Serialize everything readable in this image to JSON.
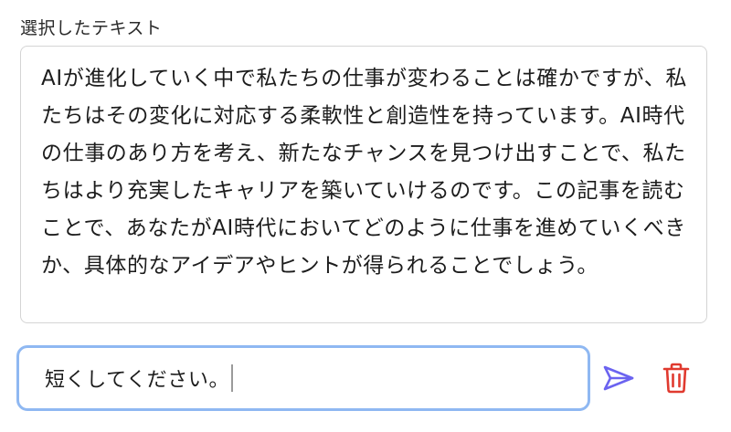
{
  "selected": {
    "label": "選択したテキスト",
    "text": "AIが進化していく中で私たちの仕事が変わることは確かですが、私たちはその変化に対応する柔軟性と創造性を持っています。AI時代の仕事のあり方を考え、新たなチャンスを見つけ出すことで、私たちはより充実したキャリアを築いていけるのです。この記事を読むことで、あなたがAI時代においてどのように仕事を進めていくべきか、具体的なアイデアやヒントが得られることでしょう。"
  },
  "prompt": {
    "value": "短くしてください。"
  },
  "icons": {
    "send": "send-icon",
    "delete": "trash-icon"
  },
  "colors": {
    "accent": "#6b63f0",
    "danger": "#e03a2f",
    "focus_border": "#8fb8f2"
  }
}
